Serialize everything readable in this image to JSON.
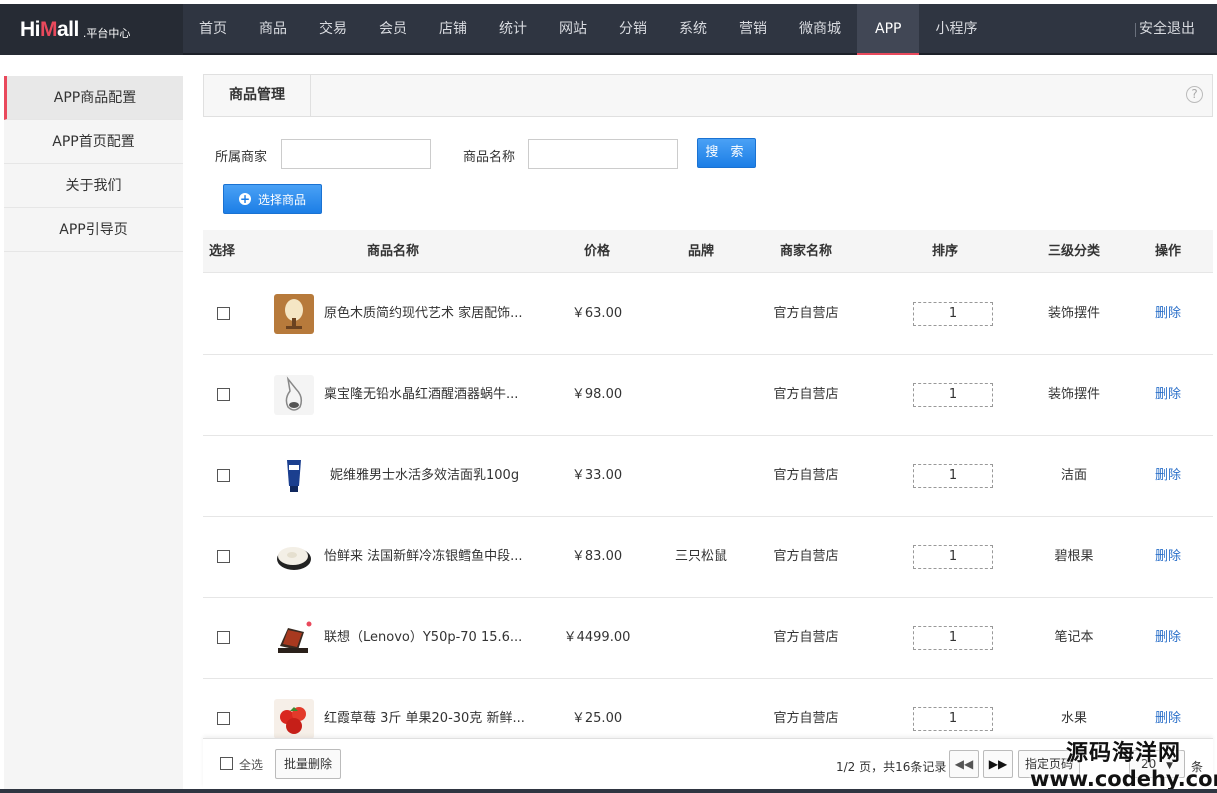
{
  "logo": {
    "brand_pre": "Hi",
    "brand_m": "M",
    "brand_post": "all",
    "sub": ".平台中心"
  },
  "nav": [
    "首页",
    "商品",
    "交易",
    "会员",
    "店铺",
    "统计",
    "网站",
    "分销",
    "系统",
    "营销",
    "微商城",
    "APP",
    "小程序"
  ],
  "nav_active": "APP",
  "logout": "安全退出",
  "sidebar": [
    "APP商品配置",
    "APP首页配置",
    "关于我们",
    "APP引导页"
  ],
  "panel": {
    "tab": "商品管理",
    "help": "?"
  },
  "filters": {
    "merchant_label": "所属商家",
    "merchant_value": "",
    "name_label": "商品名称",
    "name_value": "",
    "search": "搜 索",
    "select_goods": "选择商品"
  },
  "table": {
    "headers": [
      "选择",
      "商品名称",
      "价格",
      "品牌",
      "商家名称",
      "排序",
      "三级分类",
      "操作"
    ],
    "rows": [
      {
        "name": "原色木质简约现代艺术 家居配饰...",
        "price": "￥63.00",
        "brand": "",
        "shop": "官方自营店",
        "sort": "1",
        "category": "装饰摆件",
        "action": "删除",
        "thumb": "lamp"
      },
      {
        "name": "稟宝隆无铅水晶红酒醒酒器蜗牛...",
        "price": "￥98.00",
        "brand": "",
        "shop": "官方自营店",
        "sort": "1",
        "category": "装饰摆件",
        "action": "删除",
        "thumb": "decanter"
      },
      {
        "name": "妮维雅男士水活多效洁面乳100g",
        "price": "￥33.00",
        "brand": "",
        "shop": "官方自营店",
        "sort": "1",
        "category": "洁面",
        "action": "删除",
        "thumb": "tube"
      },
      {
        "name": "怡鲜来 法国新鲜冷冻银鳕鱼中段...",
        "price": "￥83.00",
        "brand": "三只松鼠",
        "shop": "官方自营店",
        "sort": "1",
        "category": "碧根果",
        "action": "删除",
        "thumb": "fish"
      },
      {
        "name": "联想（Lenovo）Y50p-70 15.6...",
        "price": "￥4499.00",
        "brand": "",
        "shop": "官方自营店",
        "sort": "1",
        "category": "笔记本",
        "action": "删除",
        "thumb": "laptop"
      },
      {
        "name": "红霞草莓 3斤 单果20-30克 新鲜...",
        "price": "￥25.00",
        "brand": "",
        "shop": "官方自营店",
        "sort": "1",
        "category": "水果",
        "action": "删除",
        "thumb": "strawberry"
      }
    ]
  },
  "footer": {
    "select_all": "全选",
    "batch_delete": "批量删除",
    "page_info": "1/2 页，共16条记录",
    "prev_icon": "double-left-icon",
    "next_icon": "double-right-icon",
    "jump_label": "指定页码",
    "per_page": "20",
    "per_unit": "条"
  },
  "watermark": {
    "line1": "源码海洋网",
    "line2": "www.codehy.com"
  },
  "colors": {
    "nav_bg": "#2f3541",
    "accent": "#e9495c",
    "button_blue": "#1c7ee6",
    "link_blue": "#2a6fc9"
  }
}
